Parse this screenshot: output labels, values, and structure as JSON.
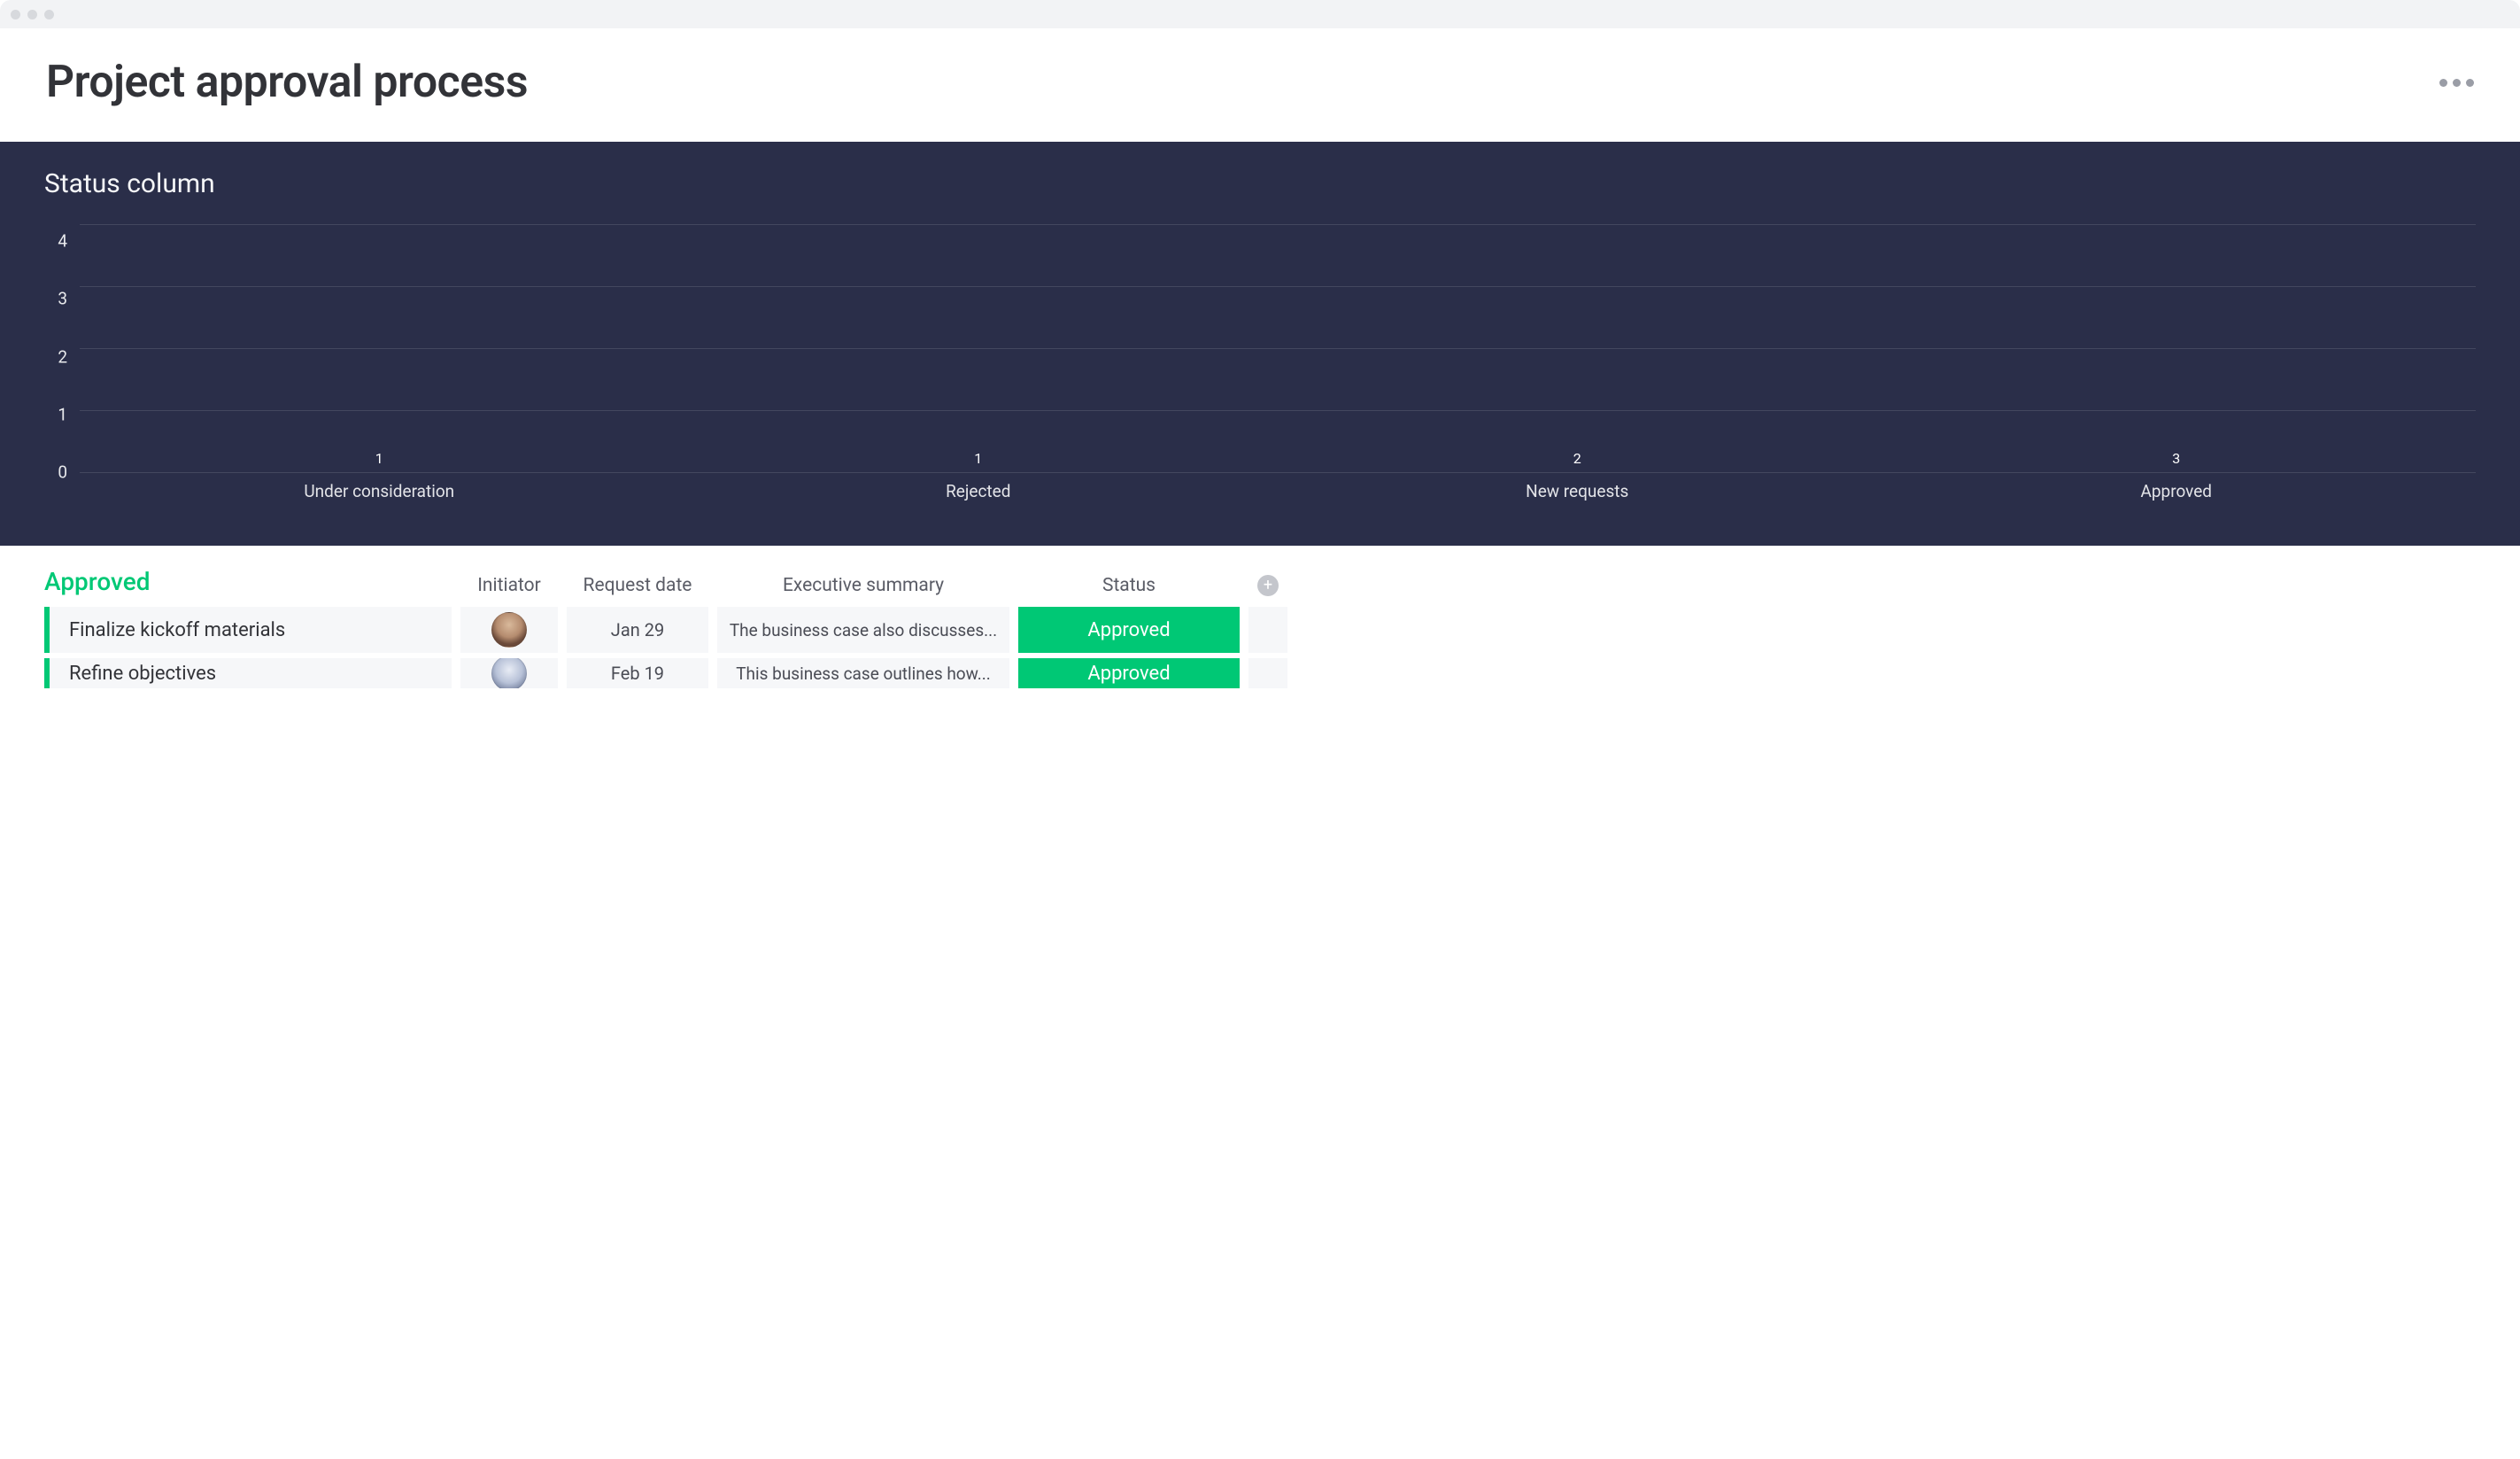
{
  "header": {
    "title": "Project approval process"
  },
  "chart_data": {
    "type": "bar",
    "title": "Status column",
    "categories": [
      "Under consideration",
      "Rejected",
      "New requests",
      "Approved"
    ],
    "values": [
      1,
      1,
      2,
      3
    ],
    "colors": [
      "#fdab3d",
      "#e2445c",
      "#4285f4",
      "#00c875"
    ],
    "ylim": [
      0,
      4
    ],
    "yticks": [
      0,
      1,
      2,
      3,
      4
    ],
    "xlabel": "",
    "ylabel": ""
  },
  "table": {
    "group_title": "Approved",
    "columns": {
      "initiator": "Initiator",
      "request_date": "Request date",
      "exec_summary": "Executive summary",
      "status": "Status"
    },
    "rows": [
      {
        "title": "Finalize kickoff materials",
        "request_date": "Jan 29",
        "exec_summary": "The business case also discusses...",
        "status": "Approved"
      },
      {
        "title": "Refine objectives",
        "request_date": "Feb 19",
        "exec_summary": "This business case outlines how...",
        "status": "Approved"
      }
    ]
  },
  "colors": {
    "approved": "#00c875",
    "chart_bg": "#2a2e49"
  }
}
